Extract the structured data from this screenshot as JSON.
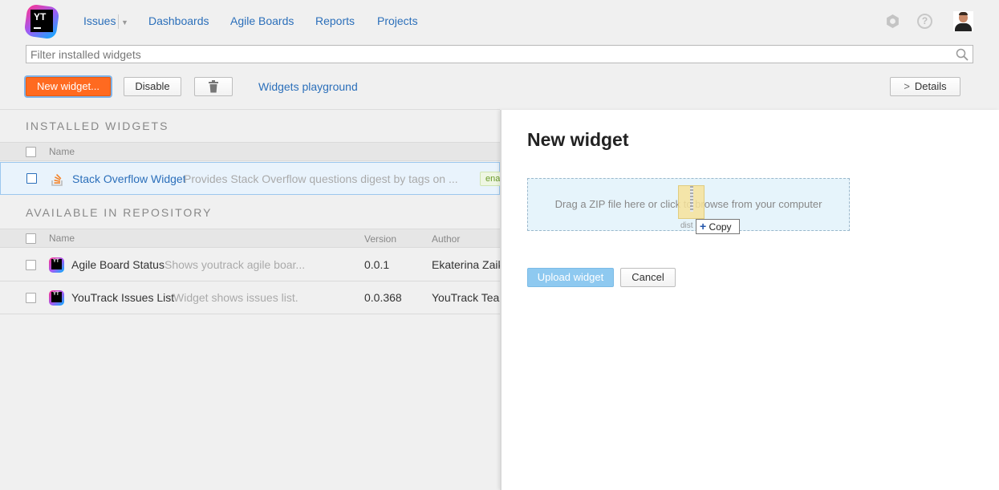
{
  "nav": {
    "logo_text": "YT",
    "issues": "Issues",
    "dashboards": "Dashboards",
    "agile_boards": "Agile Boards",
    "reports": "Reports",
    "projects": "Projects"
  },
  "filter": {
    "placeholder": "Filter installed widgets"
  },
  "toolbar": {
    "new_widget": "New widget...",
    "disable": "Disable",
    "playground": "Widgets playground",
    "details": "Details"
  },
  "installed": {
    "title": "INSTALLED WIDGETS",
    "col_name": "Name",
    "rows": [
      {
        "name": "Stack Overflow Widget",
        "desc": "Provides Stack Overflow questions digest by tags on ...",
        "badge": "enabled"
      }
    ]
  },
  "repository": {
    "title": "AVAILABLE IN REPOSITORY",
    "col_name": "Name",
    "col_version": "Version",
    "col_author": "Author",
    "rows": [
      {
        "name": "Agile Board Status",
        "desc": "Shows youtrack agile boar...",
        "version": "0.0.1",
        "author": "Ekaterina Zaikina"
      },
      {
        "name": "YouTrack Issues List",
        "desc": "Widget shows issues list.",
        "version": "0.0.368",
        "author": "YouTrack Team"
      }
    ]
  },
  "panel": {
    "title": "New widget",
    "dropzone_text": "Drag a ZIP file here or click to browse from your computer",
    "drag_file_label": "dist",
    "copy_label": "Copy",
    "upload": "Upload widget",
    "cancel": "Cancel"
  }
}
